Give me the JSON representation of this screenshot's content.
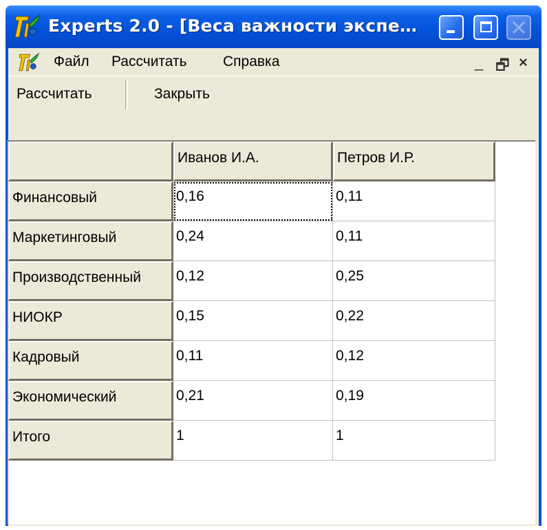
{
  "window": {
    "title": "Experts 2.0 - [Веса важности экспе…"
  },
  "menu": [
    "Файл",
    "Рассчитать",
    "Справка"
  ],
  "mdi_controls": {
    "minimize": "_",
    "restore": "🗗",
    "close": "×"
  },
  "toolbar": {
    "calculate_label": "Рассчитать",
    "close_label": "Закрыть"
  },
  "table": {
    "columns": [
      "Иванов И.А.",
      "Петров И.Р."
    ],
    "rows": [
      {
        "label": "Финансовый",
        "values": [
          "0,16",
          "0,11"
        ]
      },
      {
        "label": "Маркетинговый",
        "values": [
          "0,24",
          "0,11"
        ]
      },
      {
        "label": "Производственный",
        "values": [
          "0,12",
          "0,25"
        ]
      },
      {
        "label": "НИОКР",
        "values": [
          "0,15",
          "0,22"
        ]
      },
      {
        "label": "Кадровый",
        "values": [
          "0,11",
          "0,12"
        ]
      },
      {
        "label": "Экономический",
        "values": [
          "0,21",
          "0,19"
        ]
      },
      {
        "label": "Итого",
        "values": [
          "1",
          "1"
        ]
      }
    ]
  },
  "colors": {
    "title_bar": "#0452d8",
    "face": "#ece9d8",
    "grid_background": "#ffffff"
  }
}
